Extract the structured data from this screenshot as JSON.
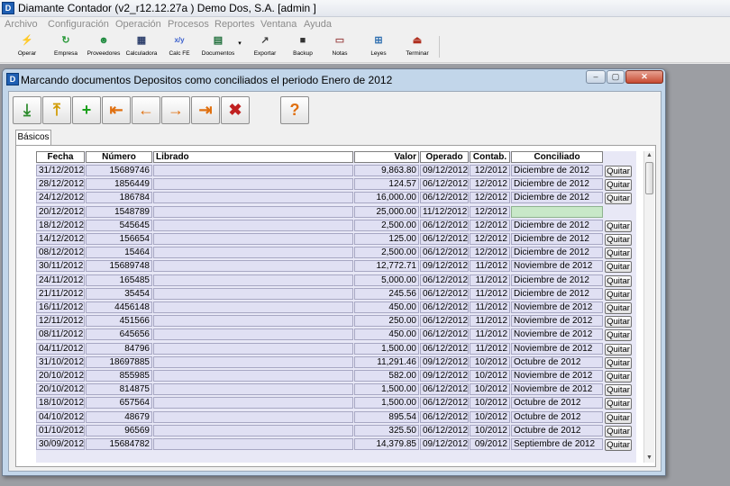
{
  "app": {
    "title": "Diamante Contador (v2_r12.12.27a ) Demo Dos, S.A.  [admin ]",
    "icon": "app-logo-icon"
  },
  "menu": [
    "Archivo",
    "Configuración",
    "Operación",
    "Procesos",
    "Reportes",
    "Ventana",
    "Ayuda"
  ],
  "toolbar": [
    {
      "label": "Operar",
      "icon": "lightning-icon",
      "color": "#e8a000"
    },
    {
      "label": "Empresa",
      "icon": "refresh-icon",
      "color": "#2a9a3a"
    },
    {
      "label": "Proveedores",
      "icon": "person-icon",
      "color": "#1e8a3e"
    },
    {
      "label": "Calculadora",
      "icon": "calculator-icon",
      "color": "#2c3e6b"
    },
    {
      "label": "Calc FE",
      "icon": "formula-icon",
      "color": "#3a5fcd"
    },
    {
      "label": "Documentos",
      "icon": "documents-icon",
      "color": "#1e6e3a"
    },
    {
      "label": "Exportar",
      "icon": "export-icon",
      "color": "#444444"
    },
    {
      "label": "Backup",
      "icon": "disk-icon",
      "color": "#333333"
    },
    {
      "label": "Notas",
      "icon": "notes-icon",
      "color": "#a05050"
    },
    {
      "label": "Leyes",
      "icon": "law-icon",
      "color": "#3070b0"
    },
    {
      "label": "Terminar",
      "icon": "exit-door-icon",
      "color": "#b03020"
    }
  ],
  "window": {
    "title": "Marcando documentos Depositos como conciliados el periodo Enero de 2012",
    "tab": "Básicos"
  },
  "actions": [
    {
      "name": "import-down-button",
      "icon": "down-arrow-tray-icon",
      "glyph": "⤓",
      "color": "#2a8a2a"
    },
    {
      "name": "import-up-button",
      "icon": "up-arrow-tray-icon",
      "glyph": "⤒",
      "color": "#d09a00"
    },
    {
      "name": "new-document-button",
      "icon": "new-page-icon",
      "glyph": "+",
      "color": "#1aa01a"
    },
    {
      "name": "first-record-button",
      "icon": "first-arrow-icon",
      "glyph": "⇤",
      "color": "#e07010"
    },
    {
      "name": "previous-record-button",
      "icon": "left-arrow-icon",
      "glyph": "←",
      "color": "#e07010"
    },
    {
      "name": "next-record-button",
      "icon": "right-arrow-icon",
      "glyph": "→",
      "color": "#e07010"
    },
    {
      "name": "last-record-button",
      "icon": "last-arrow-icon",
      "glyph": "⇥",
      "color": "#e07010"
    },
    {
      "name": "delete-button",
      "icon": "trash-icon",
      "glyph": "✖",
      "color": "#c02020"
    },
    {
      "name": "help-button",
      "icon": "question-icon",
      "glyph": "?",
      "color": "#e07010"
    }
  ],
  "columns": [
    "Fecha",
    "Número",
    "Librado",
    "Valor",
    "Operado",
    "Contab.",
    "Conciliado"
  ],
  "quitar_label": "Quitar",
  "rows": [
    {
      "fecha": "31/12/2012",
      "numero": "15689746",
      "librado": "",
      "valor": "9,863.80",
      "operado": "09/12/2012",
      "contab": "12/2012",
      "conciliado": "Diciembre de 2012",
      "quitar": true
    },
    {
      "fecha": "28/12/2012",
      "numero": "1856449",
      "librado": "",
      "valor": "124.57",
      "operado": "06/12/2012",
      "contab": "12/2012",
      "conciliado": "Diciembre de 2012",
      "quitar": true
    },
    {
      "fecha": "24/12/2012",
      "numero": "186784",
      "librado": "",
      "valor": "16,000.00",
      "operado": "06/12/2012",
      "contab": "12/2012",
      "conciliado": "Diciembre de 2012",
      "quitar": true
    },
    {
      "fecha": "20/12/2012",
      "numero": "1548789",
      "librado": "",
      "valor": "25,000.00",
      "operado": "11/12/2012",
      "contab": "12/2012",
      "conciliado": "",
      "quitar": false
    },
    {
      "fecha": "18/12/2012",
      "numero": "545645",
      "librado": "",
      "valor": "2,500.00",
      "operado": "06/12/2012",
      "contab": "12/2012",
      "conciliado": "Diciembre de 2012",
      "quitar": true
    },
    {
      "fecha": "14/12/2012",
      "numero": "156654",
      "librado": "",
      "valor": "125.00",
      "operado": "06/12/2012",
      "contab": "12/2012",
      "conciliado": "Diciembre de 2012",
      "quitar": true
    },
    {
      "fecha": "08/12/2012",
      "numero": "15464",
      "librado": "",
      "valor": "2,500.00",
      "operado": "06/12/2012",
      "contab": "12/2012",
      "conciliado": "Diciembre de 2012",
      "quitar": true
    },
    {
      "fecha": "30/11/2012",
      "numero": "15689748",
      "librado": "",
      "valor": "12,772.71",
      "operado": "09/12/2012",
      "contab": "11/2012",
      "conciliado": "Noviembre de 2012",
      "quitar": true
    },
    {
      "fecha": "24/11/2012",
      "numero": "165485",
      "librado": "",
      "valor": "5,000.00",
      "operado": "06/12/2012",
      "contab": "11/2012",
      "conciliado": "Diciembre de 2012",
      "quitar": true
    },
    {
      "fecha": "21/11/2012",
      "numero": "35454",
      "librado": "",
      "valor": "245.56",
      "operado": "06/12/2012",
      "contab": "11/2012",
      "conciliado": "Diciembre de 2012",
      "quitar": true
    },
    {
      "fecha": "16/11/2012",
      "numero": "4456148",
      "librado": "",
      "valor": "450.00",
      "operado": "06/12/2012",
      "contab": "11/2012",
      "conciliado": "Noviembre de 2012",
      "quitar": true
    },
    {
      "fecha": "12/11/2012",
      "numero": "451566",
      "librado": "",
      "valor": "250.00",
      "operado": "06/12/2012",
      "contab": "11/2012",
      "conciliado": "Noviembre de 2012",
      "quitar": true
    },
    {
      "fecha": "08/11/2012",
      "numero": "645656",
      "librado": "",
      "valor": "450.00",
      "operado": "06/12/2012",
      "contab": "11/2012",
      "conciliado": "Noviembre de 2012",
      "quitar": true
    },
    {
      "fecha": "04/11/2012",
      "numero": "84796",
      "librado": "",
      "valor": "1,500.00",
      "operado": "06/12/2012",
      "contab": "11/2012",
      "conciliado": "Noviembre de 2012",
      "quitar": true
    },
    {
      "fecha": "31/10/2012",
      "numero": "18697885",
      "librado": "",
      "valor": "11,291.46",
      "operado": "09/12/2012",
      "contab": "10/2012",
      "conciliado": "Octubre de 2012",
      "quitar": true
    },
    {
      "fecha": "20/10/2012",
      "numero": "855985",
      "librado": "",
      "valor": "582.00",
      "operado": "09/12/2012",
      "contab": "10/2012",
      "conciliado": "Noviembre de 2012",
      "quitar": true
    },
    {
      "fecha": "20/10/2012",
      "numero": "814875",
      "librado": "",
      "valor": "1,500.00",
      "operado": "06/12/2012",
      "contab": "10/2012",
      "conciliado": "Noviembre de 2012",
      "quitar": true
    },
    {
      "fecha": "18/10/2012",
      "numero": "657564",
      "librado": "",
      "valor": "1,500.00",
      "operado": "06/12/2012",
      "contab": "10/2012",
      "conciliado": "Octubre de 2012",
      "quitar": true
    },
    {
      "fecha": "04/10/2012",
      "numero": "48679",
      "librado": "",
      "valor": "895.54",
      "operado": "06/12/2012",
      "contab": "10/2012",
      "conciliado": "Octubre de 2012",
      "quitar": true
    },
    {
      "fecha": "01/10/2012",
      "numero": "96569",
      "librado": "",
      "valor": "325.50",
      "operado": "06/12/2012",
      "contab": "10/2012",
      "conciliado": "Octubre de 2012",
      "quitar": true
    },
    {
      "fecha": "30/09/2012",
      "numero": "15684782",
      "librado": "",
      "valor": "14,379.85",
      "operado": "09/12/2012",
      "contab": "09/2012",
      "conciliado": "Septiembre de 2012",
      "quitar": true
    }
  ]
}
